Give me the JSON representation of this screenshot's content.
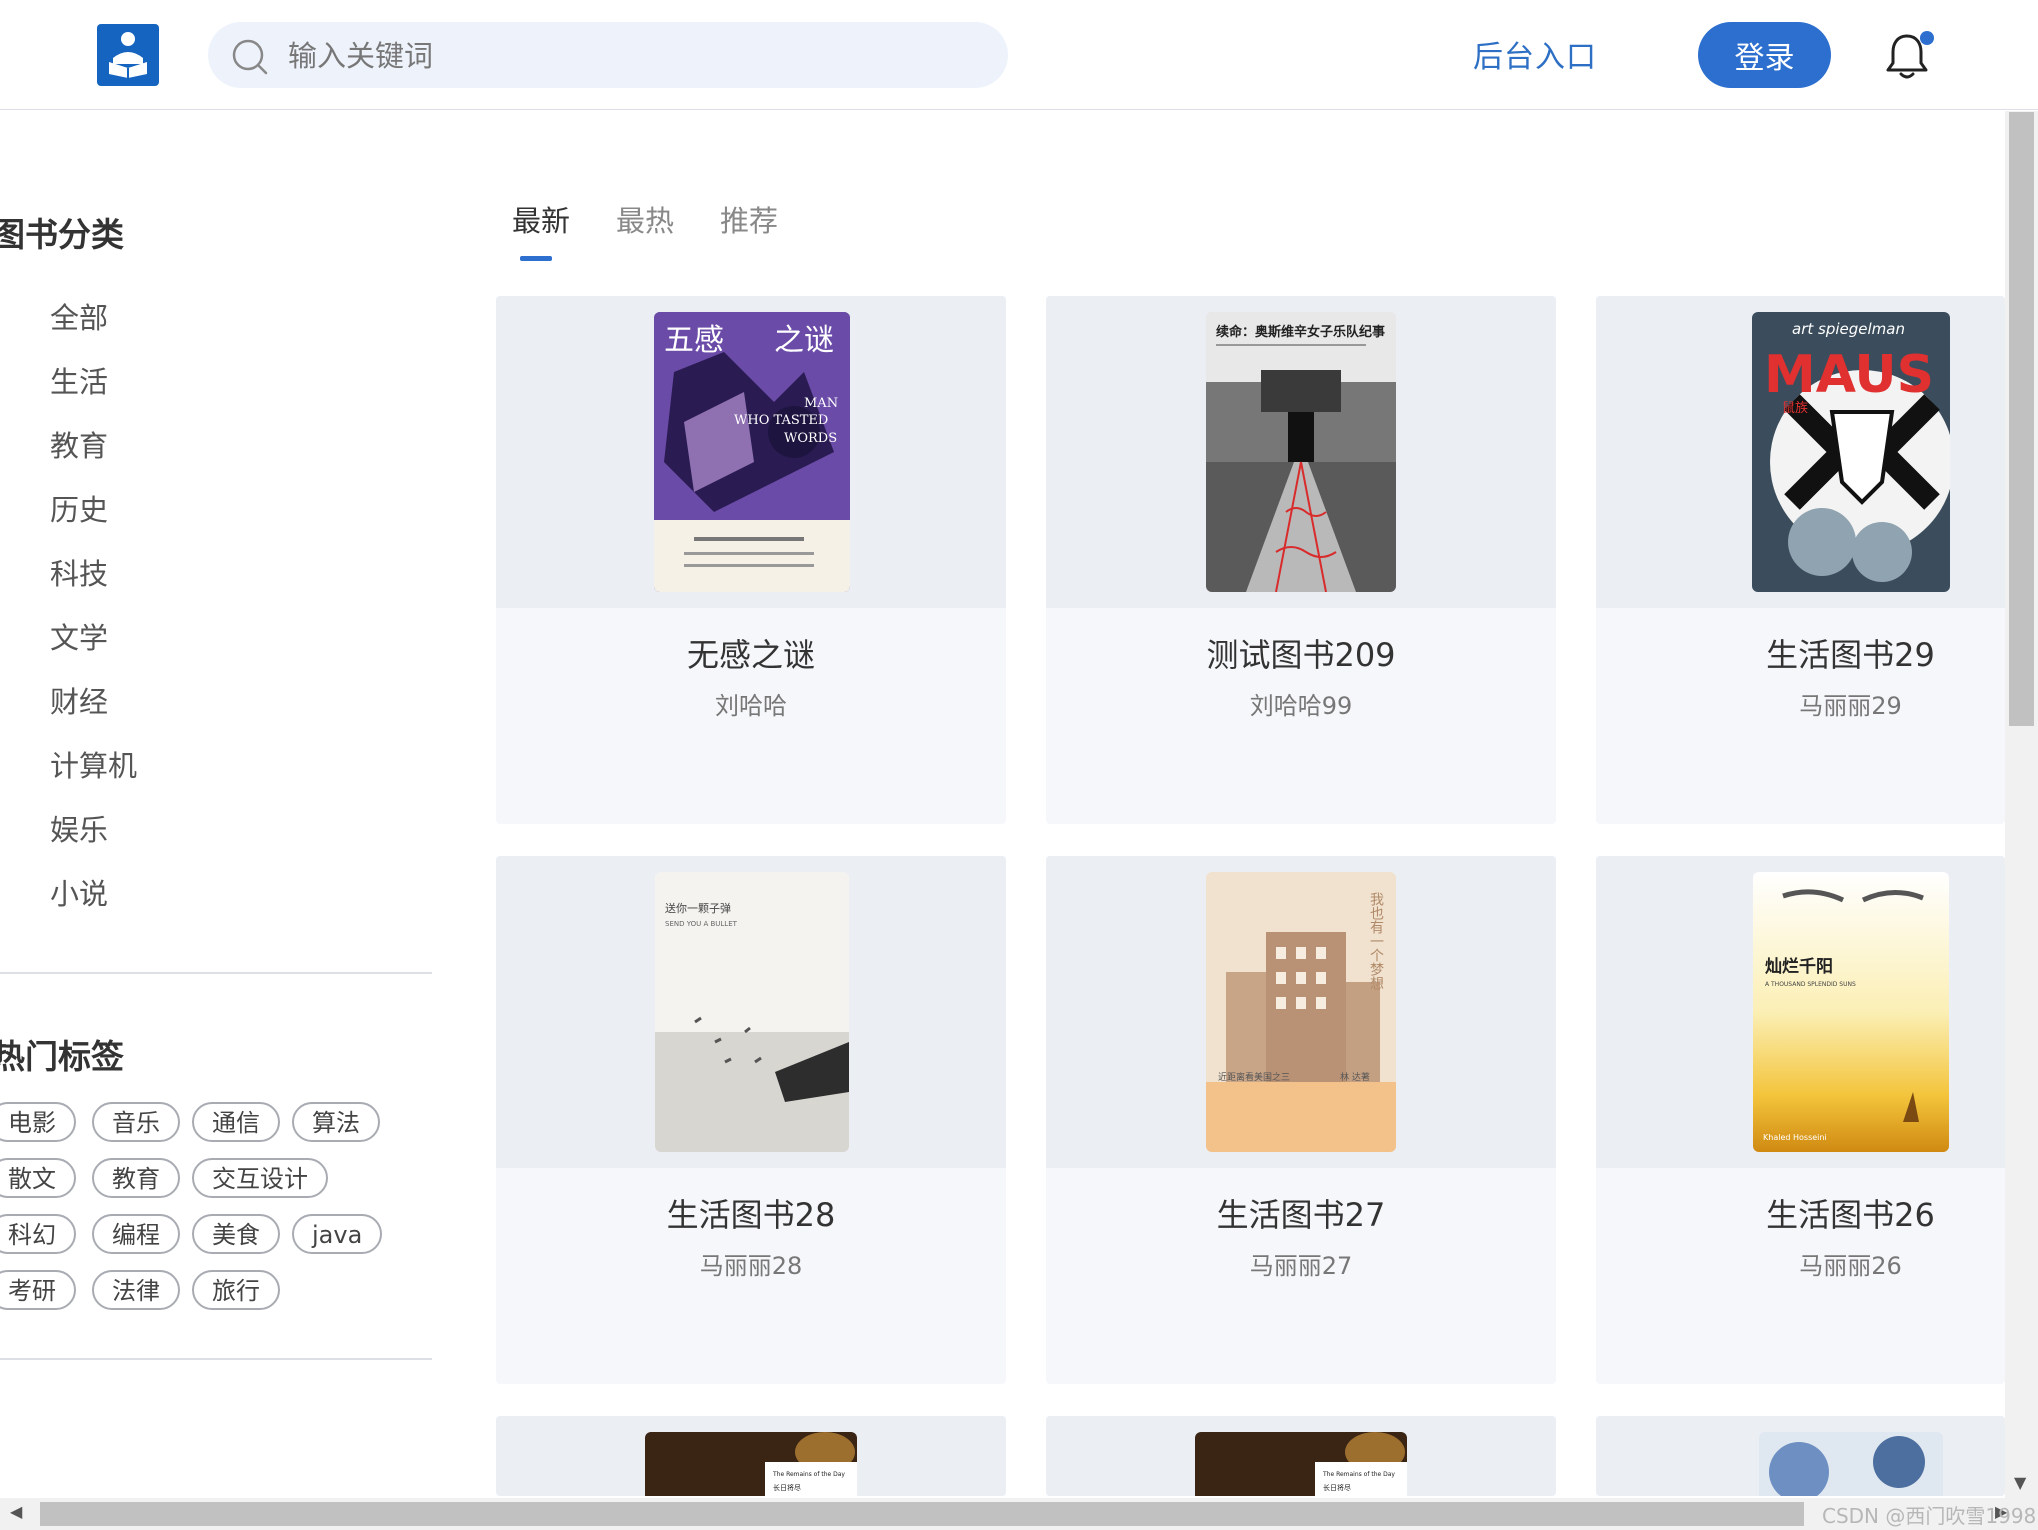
{
  "header": {
    "logo_label": "library-logo",
    "search_placeholder": "输入关键词",
    "admin_link": "后台入口",
    "login_button": "登录",
    "accent": "#2d6fcf"
  },
  "sidebar": {
    "category_title": "图书分类",
    "categories": [
      "全部",
      "生活",
      "教育",
      "历史",
      "科技",
      "文学",
      "财经",
      "计算机",
      "娱乐",
      "小说"
    ],
    "tags_title": "热门标签",
    "tag_rows": [
      [
        "电影",
        "音乐",
        "通信",
        "算法"
      ],
      [
        "散文",
        "教育",
        "交互设计"
      ],
      [
        "科幻",
        "编程",
        "美食",
        "java"
      ],
      [
        "考研",
        "法律",
        "旅行"
      ]
    ]
  },
  "tabs": [
    "最新",
    "最热",
    "推荐"
  ],
  "books": [
    {
      "title": "无感之谜",
      "author": "刘哈哈"
    },
    {
      "title": "测试图书209",
      "author": "刘哈哈99"
    },
    {
      "title": "生活图书29",
      "author": "马丽丽29"
    },
    {
      "title": "生活图书28",
      "author": "马丽丽28"
    },
    {
      "title": "生活图书27",
      "author": "马丽丽27"
    },
    {
      "title": "生活图书26",
      "author": "马丽丽26"
    }
  ],
  "covers": {
    "c1": {
      "top_left": "五感",
      "top_right": "之谜",
      "en1": "MAN",
      "en2": "WHO TASTED",
      "en3": "WORDS"
    },
    "c2": {
      "headline": "续命：奥斯维辛女子乐队纪事"
    },
    "c3": {
      "author": "art spiegelman",
      "title": "MAUS",
      "sub": "鼠族"
    },
    "c4": {
      "line1": "送你一颗子弹",
      "line2": "SEND YOU A BULLET"
    },
    "c5": {
      "vertical": "我也有一个梦想",
      "bottom_left": "近距离看美国之三",
      "bottom_right": "林 达著"
    },
    "c6": {
      "title": "灿烂千阳",
      "en": "A THOUSAND SPLENDID SUNS",
      "author": "Khaled Hosseini"
    },
    "c7": {
      "title": "The Remains of the Day",
      "zh": "长日将尽"
    }
  },
  "watermark": "CSDN @西门吹雪1998"
}
